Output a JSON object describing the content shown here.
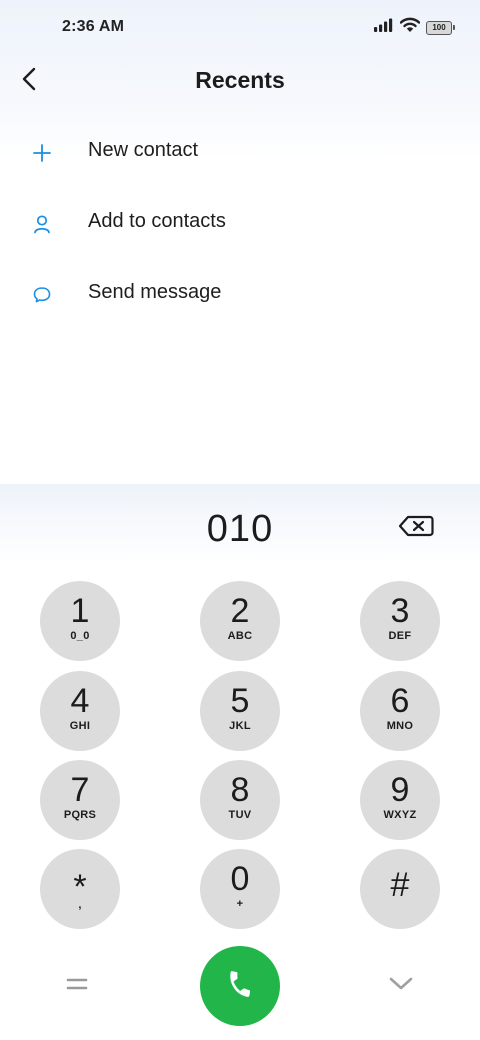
{
  "status_bar": {
    "time": "2:36 AM",
    "battery": "100"
  },
  "header": {
    "title": "Recents"
  },
  "actions": [
    {
      "label": "New contact",
      "icon": "plus-icon"
    },
    {
      "label": "Add to contacts",
      "icon": "person-icon"
    },
    {
      "label": "Send message",
      "icon": "chat-bubble-icon"
    }
  ],
  "dialer": {
    "number": "010",
    "keys": [
      {
        "digit": "1",
        "letters": "0_0"
      },
      {
        "digit": "2",
        "letters": "ABC"
      },
      {
        "digit": "3",
        "letters": "DEF"
      },
      {
        "digit": "4",
        "letters": "GHI"
      },
      {
        "digit": "5",
        "letters": "JKL"
      },
      {
        "digit": "6",
        "letters": "MNO"
      },
      {
        "digit": "7",
        "letters": "PQRS"
      },
      {
        "digit": "8",
        "letters": "TUV"
      },
      {
        "digit": "9",
        "letters": "WXYZ"
      },
      {
        "digit": "*",
        "letters": ","
      },
      {
        "digit": "0",
        "letters": "+"
      },
      {
        "digit": "#",
        "letters": ""
      }
    ]
  },
  "colors": {
    "accent": "#1a8fe3",
    "call_green": "#22b64a",
    "key_bg": "#dcdcdc"
  }
}
